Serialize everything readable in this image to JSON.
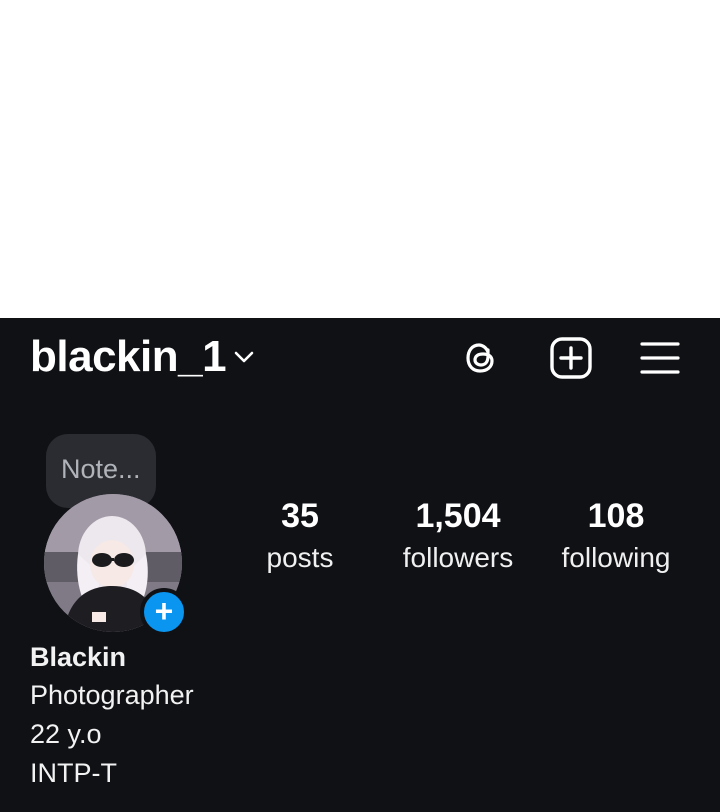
{
  "header": {
    "username": "blackin_1",
    "icons": [
      "chevron-down-icon",
      "threads-icon",
      "create-plus-icon",
      "hamburger-menu-icon"
    ]
  },
  "note": {
    "placeholder": "Note..."
  },
  "stats": {
    "posts": {
      "value": "35",
      "label": "posts"
    },
    "followers": {
      "value": "1,504",
      "label": "followers"
    },
    "following": {
      "value": "108",
      "label": "following"
    }
  },
  "bio": {
    "name": "Blackin",
    "lines": [
      "Photographer",
      "22 y.o",
      "INTP-T"
    ]
  },
  "colors": {
    "background": "#0f1115",
    "accent_blue": "#0a95f0",
    "note_bubble": "#2a2c31"
  }
}
